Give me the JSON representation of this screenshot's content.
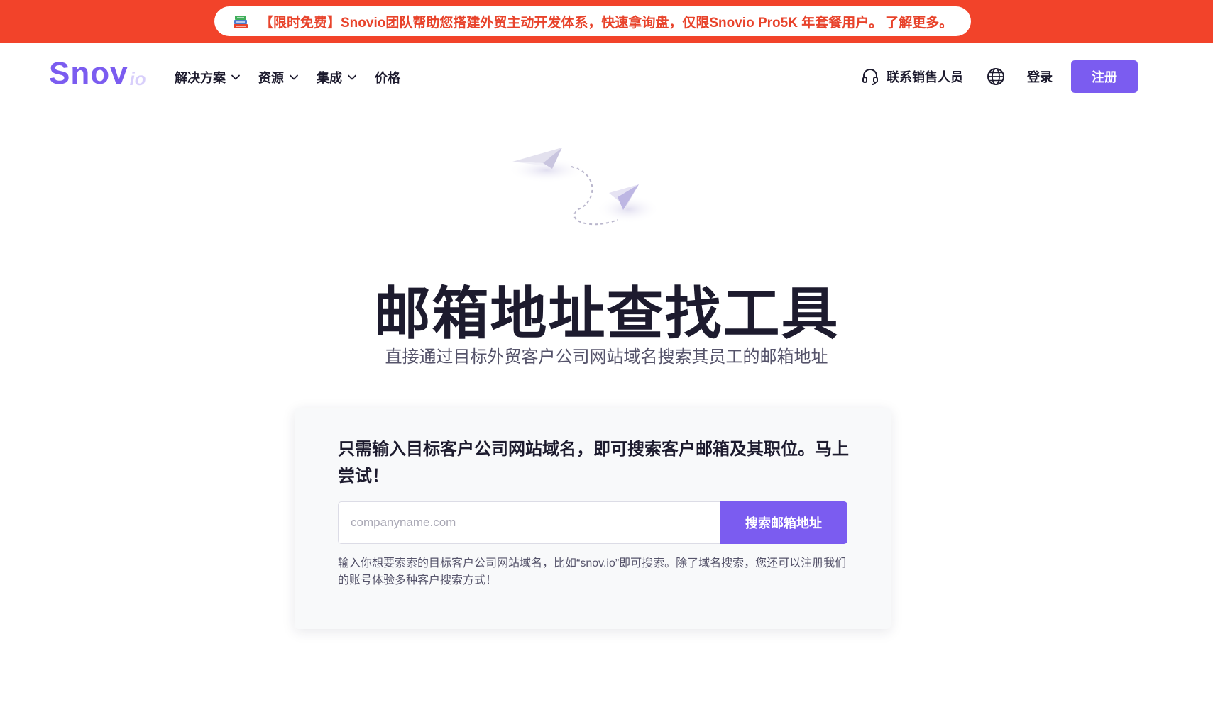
{
  "promo": {
    "icon": "books-icon",
    "text": "【限时免费】Snovio团队帮助您搭建外贸主动开发体系，快速拿询盘，仅限Snovio Pro5K 年套餐用户。",
    "link_label": "了解更多。",
    "background_color": "#f2432a",
    "text_color": "#e8432b"
  },
  "nav": {
    "logo_main": "Snov",
    "logo_sub": "io",
    "menu": [
      {
        "label": "解决方案",
        "has_dropdown": true
      },
      {
        "label": "资源",
        "has_dropdown": true
      },
      {
        "label": "集成",
        "has_dropdown": true
      },
      {
        "label": "价格",
        "has_dropdown": false
      }
    ],
    "contact_label": "联系销售人员",
    "contact_icon": "headset-icon",
    "language_icon": "globe-icon",
    "login_label": "登录",
    "signup_label": "注册",
    "accent_color": "#7b5cf0"
  },
  "hero": {
    "illustration": "paper-planes-icon",
    "title": "邮箱地址查找工具",
    "subtitle": "直接通过目标外贸客户公司网站域名搜索其员工的邮箱地址"
  },
  "search_card": {
    "title": "只需输入目标客户公司网站域名，即可搜索客户邮箱及其职位。马上尝试！",
    "input_value": "",
    "input_placeholder": "companyname.com",
    "button_label": "搜索邮箱地址",
    "hint": "输入你想要索索的目标客户公司网站域名，比如“snov.io”即可搜索。除了域名搜索，您还可以注册我们的账号体验多种客户搜索方式！"
  }
}
